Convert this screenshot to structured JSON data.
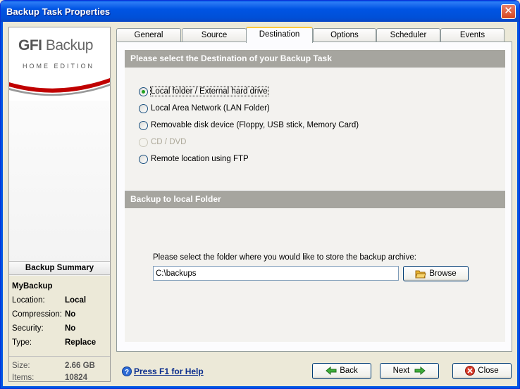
{
  "window": {
    "title": "Backup Task Properties"
  },
  "logo": {
    "brand_first": "GFI",
    "brand_second": "Backup",
    "edition": "HOME EDITION"
  },
  "tabs": [
    {
      "label": "General"
    },
    {
      "label": "Source"
    },
    {
      "label": "Destination",
      "active": true
    },
    {
      "label": "Options"
    },
    {
      "label": "Scheduler"
    },
    {
      "label": "Events"
    }
  ],
  "destination": {
    "header": "Please select the Destination of your Backup Task",
    "options": [
      {
        "label": "Local folder / External hard drive",
        "checked": true
      },
      {
        "label": "Local Area Network (LAN Folder)"
      },
      {
        "label": "Removable disk device (Floppy, USB stick, Memory Card)"
      },
      {
        "label": "CD / DVD",
        "disabled": true
      },
      {
        "label": "Remote location using FTP"
      }
    ]
  },
  "local_folder": {
    "header": "Backup to local Folder",
    "prompt": "Please select the folder where you would like to store the backup archive:",
    "path": "C:\\backups",
    "browse_label": "Browse"
  },
  "summary": {
    "header": "Backup Summary",
    "name": "MyBackup",
    "rows": [
      {
        "key": "Location:",
        "value": "Local"
      },
      {
        "key": "Compression:",
        "value": "No"
      },
      {
        "key": "Security:",
        "value": "No"
      },
      {
        "key": "Type:",
        "value": "Replace"
      }
    ],
    "stats": [
      {
        "key": "Size:",
        "value": "2.66 GB"
      },
      {
        "key": "Items:",
        "value": "10824"
      }
    ]
  },
  "footer": {
    "help": "Press F1 for Help",
    "back": "Back",
    "next": "Next",
    "close": "Close"
  },
  "colors": {
    "section_header": "#a6a59f",
    "titlebar": "#0054e3",
    "active_tab_accent": "#ffc83c"
  }
}
